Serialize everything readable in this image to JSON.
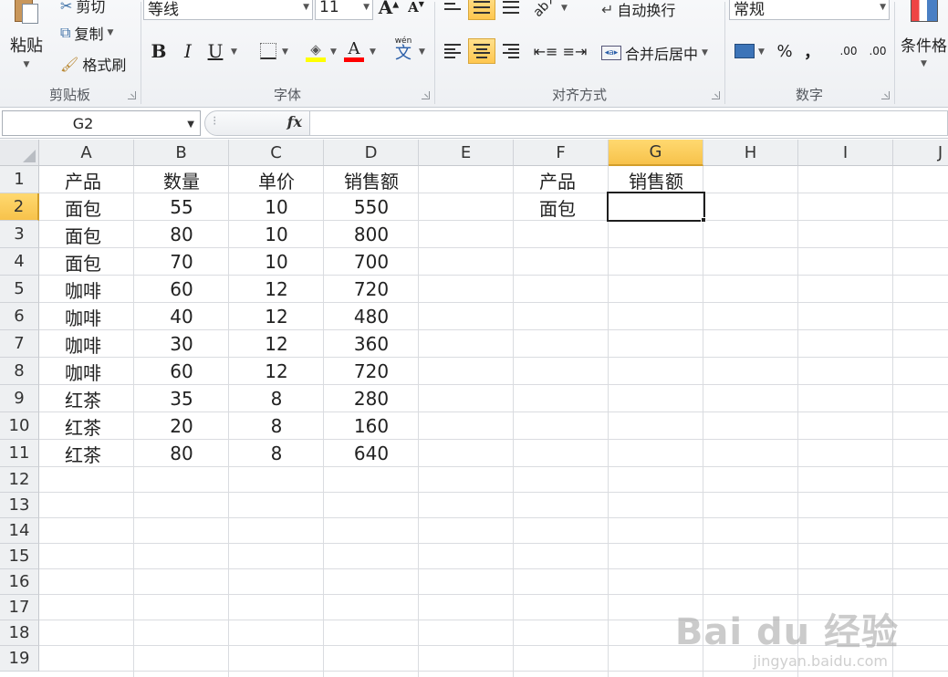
{
  "ribbon": {
    "clipboard": {
      "paste_label": "粘贴",
      "cut_label": "剪切",
      "copy_label": "复制",
      "format_painter_label": "格式刷",
      "group_label": "剪贴板"
    },
    "font": {
      "font_name": "等线",
      "font_size": "11",
      "bold": "B",
      "italic": "I",
      "underline": "U",
      "fill_color": "#ffff00",
      "font_color": "#ff0000",
      "font_color_letter": "A",
      "phonetic_label": "wén",
      "phonetic_char": "文",
      "group_label": "字体"
    },
    "alignment": {
      "wrap_text_label": "自动换行",
      "merge_center_label": "合并后居中",
      "group_label": "对齐方式"
    },
    "number": {
      "format_value": "常规",
      "percent": "%",
      "comma": "，",
      "increase_decimal": ".00",
      "decrease_decimal": ".00",
      "group_label": "数字"
    },
    "styles": {
      "conditional_format_label": "条件格"
    }
  },
  "formula_bar": {
    "name_box": "G2",
    "fx_label": "fx",
    "formula": ""
  },
  "sheet": {
    "columns": [
      "A",
      "B",
      "C",
      "D",
      "E",
      "F",
      "G",
      "H",
      "I",
      "J"
    ],
    "rows": [
      "1",
      "2",
      "3",
      "4",
      "5",
      "6",
      "7",
      "8",
      "9",
      "10",
      "11",
      "12",
      "13",
      "14",
      "15",
      "16",
      "17",
      "18",
      "19"
    ],
    "selected_column": "G",
    "selected_row": "2",
    "table": {
      "headers": [
        "产品",
        "数量",
        "单价",
        "销售额"
      ],
      "rows": [
        [
          "面包",
          "55",
          "10",
          "550"
        ],
        [
          "面包",
          "80",
          "10",
          "800"
        ],
        [
          "面包",
          "70",
          "10",
          "700"
        ],
        [
          "咖啡",
          "60",
          "12",
          "720"
        ],
        [
          "咖啡",
          "40",
          "12",
          "480"
        ],
        [
          "咖啡",
          "30",
          "12",
          "360"
        ],
        [
          "咖啡",
          "60",
          "12",
          "720"
        ],
        [
          "红茶",
          "35",
          "8",
          "280"
        ],
        [
          "红茶",
          "20",
          "8",
          "160"
        ],
        [
          "红茶",
          "80",
          "8",
          "640"
        ]
      ]
    },
    "lookup": {
      "f1": "产品",
      "g1": "销售额",
      "f2": "面包",
      "g2": ""
    }
  },
  "watermark": {
    "logo_text": "Bai du 经验",
    "url_text": "jingyan.baidu.com"
  }
}
